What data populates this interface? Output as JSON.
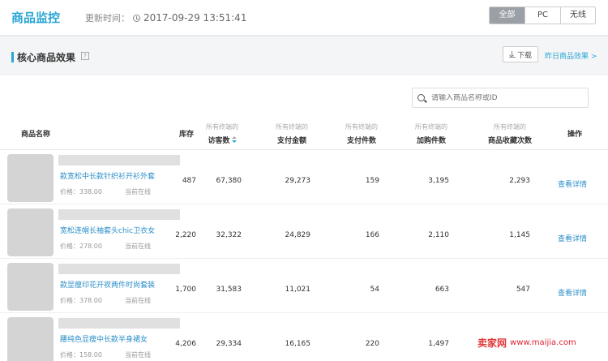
{
  "header": {
    "title": "商品监控",
    "update_label": "更新时间：",
    "update_time": "2017-09-29 13:51:41",
    "segments": [
      "全部",
      "PC",
      "无线"
    ]
  },
  "section": {
    "title": "核心商品效果",
    "help": "?",
    "download_label": "下载",
    "yesterday_link": "昨日商品效果 >"
  },
  "search": {
    "placeholder": "请输入商品名称或ID"
  },
  "table": {
    "col_name": "商品名称",
    "col_stock": "库存",
    "col_sub": "所有终端的",
    "col_visitors": "访客数",
    "col_pay_amount": "支付金额",
    "col_pay_items": "支付件数",
    "col_cart": "加购件数",
    "col_fav": "商品收藏次数",
    "col_action": "操作",
    "rows": [
      {
        "name": "款宽松中长款针织衫开衫外套",
        "price": "价格：338.00",
        "status": "当前在线",
        "stock": "487",
        "visitors": "67,380",
        "pay_amount": "29,273",
        "pay_items": "159",
        "cart": "3,195",
        "fav": "2,293",
        "action": "查看详情"
      },
      {
        "name": "宽松连帽长袖套头chic卫衣女",
        "price": "价格：278.00",
        "status": "当前在线",
        "stock": "2,220",
        "visitors": "32,322",
        "pay_amount": "24,829",
        "pay_items": "166",
        "cart": "2,110",
        "fav": "1,145",
        "action": "查看详情"
      },
      {
        "name": "款显瘦印花开衩两件时尚套装",
        "price": "价格：378.00",
        "status": "当前在线",
        "stock": "1,700",
        "visitors": "31,583",
        "pay_amount": "11,021",
        "pay_items": "54",
        "cart": "663",
        "fav": "547",
        "action": "查看详情"
      },
      {
        "name": "腰纯色显瘦中长款半身裙女",
        "price": "价格：158.00",
        "status": "当前在线",
        "stock": "4,206",
        "visitors": "29,334",
        "pay_amount": "16,165",
        "pay_items": "220",
        "cart": "1,497",
        "fav": "",
        "action": ""
      }
    ]
  },
  "watermark": {
    "brand": "卖家网",
    "url": "www.maijia.com"
  }
}
